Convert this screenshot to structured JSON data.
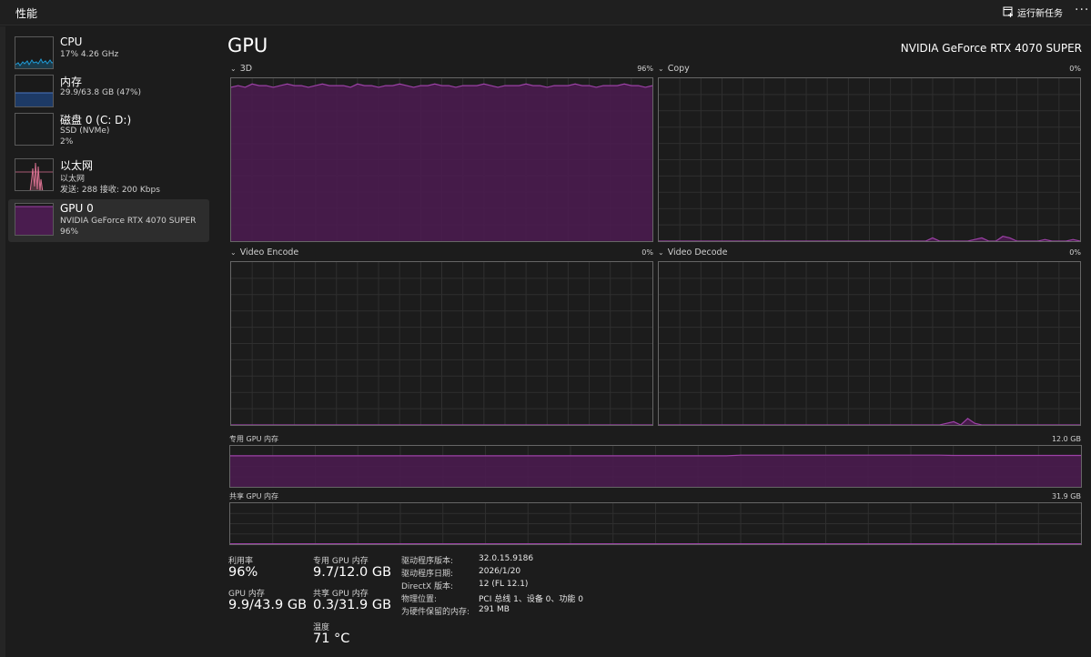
{
  "titlebar": {
    "title": "性能",
    "run_task_label": "运行新任务",
    "more_label": "···"
  },
  "sidebar": {
    "items": [
      {
        "name": "CPU",
        "sub1": "17% 4.26 GHz",
        "sub2": "",
        "sub3": ""
      },
      {
        "name": "内存",
        "sub1": "29.9/63.8 GB (47%)",
        "sub2": "",
        "sub3": ""
      },
      {
        "name": "磁盘 0 (C: D:)",
        "sub1": "SSD (NVMe)",
        "sub2": "2%",
        "sub3": ""
      },
      {
        "name": "以太网",
        "sub1": "以太网",
        "sub2": "发送: 288 接收: 200 Kbps",
        "sub3": ""
      },
      {
        "name": "GPU 0",
        "sub1": "NVIDIA GeForce RTX 4070 SUPER",
        "sub2": "96%",
        "sub3": ""
      }
    ]
  },
  "main": {
    "title": "GPU",
    "gpu_model": "NVIDIA GeForce RTX 4070 SUPER",
    "charts": {
      "d3": {
        "label": "3D",
        "max": "96%"
      },
      "copy": {
        "label": "Copy",
        "max": "0%"
      },
      "encode": {
        "label": "Video Encode",
        "max": "0%"
      },
      "decode": {
        "label": "Video Decode",
        "max": "0%"
      },
      "dedicated": {
        "label": "专用 GPU 内存",
        "max": "12.0 GB"
      },
      "shared": {
        "label": "共享 GPU 内存",
        "max": "31.9 GB"
      }
    }
  },
  "stats": {
    "utilization": {
      "label": "利用率",
      "value": "96%"
    },
    "gpu_memory": {
      "label": "GPU 内存",
      "value": "9.9/43.9 GB"
    },
    "dedicated_memory": {
      "label": "专用 GPU 内存",
      "value": "9.7/12.0 GB"
    },
    "shared_memory": {
      "label": "共享 GPU 内存",
      "value": "0.3/31.9 GB"
    },
    "temperature": {
      "label": "温度",
      "value": "71 °C"
    }
  },
  "info": [
    {
      "key": "驱动程序版本:",
      "value": "32.0.15.9186"
    },
    {
      "key": "驱动程序日期:",
      "value": "2026/1/20"
    },
    {
      "key": "DirectX 版本:",
      "value": "12 (FL 12.1)"
    },
    {
      "key": "物理位置:",
      "value": "PCI 总线 1、设备 0、功能 0"
    },
    {
      "key": "为硬件保留的内存:",
      "value": "291 MB"
    }
  ],
  "colors": {
    "gpu_line": "#9c41a6",
    "gpu_fill": "#4a1c4f",
    "cpu_line": "#1f9bd6",
    "mem_line": "#4b78c2",
    "net_line": "#d87090",
    "grid": "#2f2f2f"
  },
  "chart_data": [
    {
      "type": "area",
      "name_ref": "3D",
      "ylim": [
        0,
        100
      ],
      "values": [
        95,
        96,
        95,
        97,
        96,
        96,
        95,
        96,
        97,
        96,
        96,
        95,
        96,
        97,
        96,
        96,
        96,
        95,
        97,
        96,
        96,
        95,
        96,
        96,
        97,
        96,
        95,
        96,
        96,
        97,
        96,
        96,
        95,
        96,
        96,
        96,
        97,
        96,
        95,
        96,
        96,
        96,
        97,
        96,
        96,
        95,
        96,
        96,
        96,
        97,
        96,
        96,
        95,
        96,
        96,
        96,
        97,
        96,
        96,
        95,
        96
      ]
    },
    {
      "type": "area",
      "name_ref": "Copy",
      "ylim": [
        0,
        100
      ],
      "values": [
        0,
        0,
        0,
        0,
        0,
        0,
        0,
        0,
        0,
        0,
        0,
        0,
        0,
        0,
        0,
        0,
        0,
        0,
        0,
        0,
        0,
        0,
        0,
        0,
        0,
        0,
        0,
        0,
        0,
        0,
        0,
        0,
        0,
        0,
        0,
        0,
        0,
        0,
        0,
        2,
        0,
        0,
        0,
        0,
        0,
        1,
        2,
        0,
        0,
        3,
        2,
        0,
        0,
        0,
        0,
        1,
        0,
        0,
        0,
        1,
        0
      ]
    },
    {
      "type": "area",
      "name_ref": "Video Encode",
      "ylim": [
        0,
        100
      ],
      "values": [
        0,
        0,
        0,
        0,
        0,
        0,
        0,
        0,
        0,
        0,
        0,
        0,
        0,
        0,
        0,
        0,
        0,
        0,
        0,
        0,
        0,
        0,
        0,
        0,
        0,
        0,
        0,
        0,
        0,
        0,
        0,
        0,
        0,
        0,
        0,
        0,
        0,
        0,
        0,
        0,
        0,
        0,
        0,
        0,
        0,
        0,
        0,
        0,
        0,
        0,
        0,
        0,
        0,
        0,
        0,
        0,
        0,
        0,
        0,
        0,
        0
      ]
    },
    {
      "type": "area",
      "name_ref": "Video Decode",
      "ylim": [
        0,
        100
      ],
      "values": [
        0,
        0,
        0,
        0,
        0,
        0,
        0,
        0,
        0,
        0,
        0,
        0,
        0,
        0,
        0,
        0,
        0,
        0,
        0,
        0,
        0,
        0,
        0,
        0,
        0,
        0,
        0,
        0,
        0,
        0,
        0,
        0,
        0,
        0,
        0,
        0,
        0,
        0,
        0,
        0,
        0,
        1,
        2,
        0,
        4,
        1,
        0,
        0,
        0,
        0,
        0,
        0,
        0,
        0,
        0,
        0,
        0,
        0,
        0,
        0,
        0
      ]
    },
    {
      "type": "area",
      "name_ref": "专用 GPU 内存",
      "ylim": [
        0,
        12.0
      ],
      "values": [
        9.3,
        9.3,
        9.3,
        9.3,
        9.3,
        9.3,
        9.3,
        9.3,
        9.3,
        9.3,
        9.3,
        9.3,
        9.3,
        9.3,
        9.3,
        9.3,
        9.3,
        9.3,
        9.3,
        9.3,
        9.3,
        9.3,
        9.3,
        9.3,
        9.3,
        9.3,
        9.3,
        9.3,
        9.3,
        9.3,
        9.3,
        9.3,
        9.3,
        9.3,
        9.3,
        9.3,
        9.5,
        9.5,
        9.5,
        9.5,
        9.5,
        9.5,
        9.5,
        9.5,
        9.5,
        9.5,
        9.5,
        9.5,
        9.5,
        9.5,
        9.5,
        9.4,
        9.4,
        9.4,
        9.4,
        9.4,
        9.4,
        9.4,
        9.4,
        9.4,
        9.4
      ]
    },
    {
      "type": "area",
      "name_ref": "共享 GPU 内存",
      "ylim": [
        0,
        31.9
      ],
      "values": [
        0.3,
        0.3,
        0.3,
        0.3,
        0.3,
        0.3,
        0.3,
        0.3,
        0.3,
        0.3,
        0.3,
        0.3,
        0.3,
        0.3,
        0.3,
        0.3,
        0.3,
        0.3,
        0.3,
        0.3,
        0.3,
        0.3,
        0.3,
        0.3,
        0.3,
        0.3,
        0.3,
        0.3,
        0.3,
        0.3,
        0.3,
        0.3,
        0.3,
        0.3,
        0.3,
        0.3,
        0.3,
        0.3,
        0.3,
        0.3,
        0.3,
        0.3,
        0.3,
        0.3,
        0.3,
        0.3,
        0.3,
        0.3,
        0.3,
        0.3,
        0.3,
        0.3,
        0.3,
        0.3,
        0.3,
        0.3,
        0.3,
        0.3,
        0.3,
        0.3,
        0.3
      ]
    }
  ]
}
